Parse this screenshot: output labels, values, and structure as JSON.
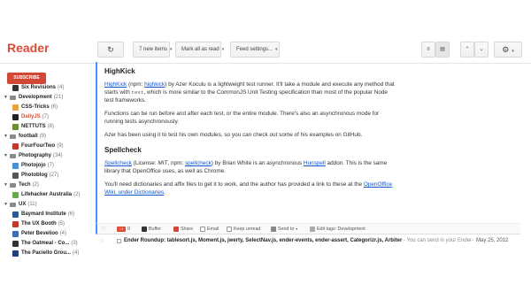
{
  "app": {
    "title": "Reader"
  },
  "toolbar": {
    "refresh_icon": "refresh-icon",
    "new_items_label": "7 new items",
    "mark_all_label": "Mark all as read",
    "feed_settings_label": "Feed settings...",
    "caret": "▾",
    "refresh_glyph": "↻",
    "gear_glyph": "⚙",
    "view_list_glyph": "≡",
    "view_expanded_glyph": "▤",
    "up_glyph": "⌃",
    "down_glyph": "⌄"
  },
  "sidebar": {
    "subscribe_label": "SUBSCRIBE",
    "items": [
      {
        "label": "Six Revisions",
        "count": "(4)"
      },
      {
        "label": "Development",
        "count": "(21)"
      },
      {
        "label": "CSS-Tricks",
        "count": "(6)"
      },
      {
        "label": "DailyJS",
        "count": "(7)"
      },
      {
        "label": "NETTUTS",
        "count": "(8)"
      },
      {
        "label": "football",
        "count": "(9)"
      },
      {
        "label": "FourFourTwo",
        "count": "(9)"
      },
      {
        "label": "Photography",
        "count": "(34)"
      },
      {
        "label": "Photojojo",
        "count": "(7)"
      },
      {
        "label": "Photoblog",
        "count": "(27)"
      },
      {
        "label": "Tech",
        "count": "(2)"
      },
      {
        "label": "Lifehacker Australia",
        "count": "(2)"
      },
      {
        "label": "UX",
        "count": "(11)"
      },
      {
        "label": "Baymard Institute",
        "count": "(6)"
      },
      {
        "label": "The UX Booth",
        "count": "(5)"
      },
      {
        "label": "Peter Bevelioo",
        "count": "(4)"
      },
      {
        "label": "The Oatmeal - Co...",
        "count": "(3)"
      },
      {
        "label": "The Paciello Grou...",
        "count": "(4)"
      }
    ]
  },
  "article": {
    "h1": "HighKick",
    "p1": {
      "link1": "HighKick",
      "t1": " (npm: ",
      "link2": "highkick",
      "t2": ") by Azer Koculu is a lightweight test runner. It'll take a module and execute any method that starts with ",
      "code": "test",
      "t3": ", which is more similar to the CommonJS Unit Testing specification than most of the popular Node test frameworks."
    },
    "p2": "Functions can be run before and after each test, or the entire module. There's also an asynchronous mode for running tests asynchronously.",
    "p3": "Azer has been using it to test his own modules, so you can check out some of his examples on GitHub.",
    "h2": "Spellcheck",
    "p4": {
      "link1": "Spellcheck",
      "t1": " (License: ",
      "license": "MIT",
      "t2": ", npm: ",
      "link2": "spellcheck",
      "t3": ") by Brian White is an asynchronous ",
      "link3": "Hunspell",
      "t4": " addon. This is the same library that OpenOffice uses, as well as Chrome."
    },
    "p5": {
      "t1": "You'll need dictionaries and affix files to get it to work, and the author has provided a link to these at the ",
      "link1": "OpenOffice Wiki, under Dictionaries",
      "t2": "."
    }
  },
  "actions": {
    "gplus_count": "+1",
    "gplus_label": "0",
    "buffer": "Buffer",
    "share": "Share",
    "email": "Email",
    "keep_unread": "Keep unread",
    "send_to": "Send to",
    "edit_tags": "Edit tags: Development"
  },
  "next_item": {
    "title": "Ender Roundup: tablesort.js, Moment.js, jwerty, SelectNav.js, ender-events, ender-assert, Categorizr.js, Arbiter",
    "snippet": " - You can send in your Ender-",
    "date": "May 25, 2012"
  },
  "colors": {
    "accent": "#dd4b39",
    "subscribe": "#d14836",
    "selection": "#4d90fe",
    "link": "#1155cc"
  }
}
